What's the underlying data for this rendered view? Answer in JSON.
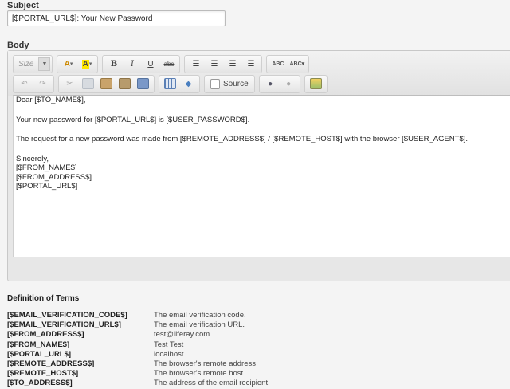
{
  "subject": {
    "label": "Subject",
    "value": "[$PORTAL_URL$]: Your New Password"
  },
  "body": {
    "label": "Body",
    "toolbar": {
      "size_placeholder": "Size",
      "source_label": "Source",
      "bold": "B",
      "italic": "I",
      "underline": "U",
      "strike": "abc",
      "spell": "ABC",
      "spell2": "ABC"
    },
    "lines": [
      "Dear [$TO_NAME$],",
      "",
      "Your new password for [$PORTAL_URL$] is [$USER_PASSWORD$].",
      "",
      "The request for a new password was made from [$REMOTE_ADDRESS$] / [$REMOTE_HOST$] with the browser [$USER_AGENT$].",
      "",
      "Sincerely,",
      "[$FROM_NAME$]",
      "[$FROM_ADDRESS$]",
      "[$PORTAL_URL$]"
    ]
  },
  "definitions": {
    "title": "Definition of Terms",
    "rows": [
      {
        "term": "[$EMAIL_VERIFICATION_CODE$]",
        "desc": "The email verification code."
      },
      {
        "term": "[$EMAIL_VERIFICATION_URL$]",
        "desc": "The email verification URL."
      },
      {
        "term": "[$FROM_ADDRESS$]",
        "desc": "test@liferay.com"
      },
      {
        "term": "[$FROM_NAME$]",
        "desc": "Test Test"
      },
      {
        "term": "[$PORTAL_URL$]",
        "desc": "localhost"
      },
      {
        "term": "[$REMOTE_ADDRESS$]",
        "desc": "The browser's remote address"
      },
      {
        "term": "[$REMOTE_HOST$]",
        "desc": "The browser's remote host"
      },
      {
        "term": "[$TO_ADDRESS$]",
        "desc": "The address of the email recipient"
      }
    ]
  },
  "colors": {
    "font_color_icon": "#cc8800",
    "bg_color_icon": "#ffe600"
  }
}
